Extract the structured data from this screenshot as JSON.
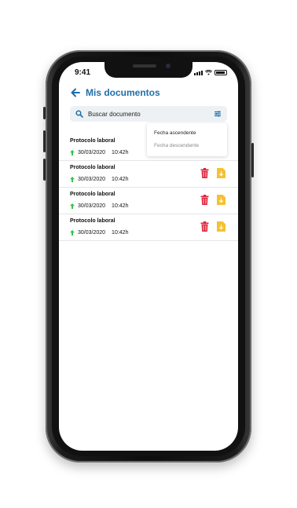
{
  "status": {
    "time": "9:41"
  },
  "header": {
    "title": "Mis documentos"
  },
  "search": {
    "placeholder": "Buscar documento"
  },
  "sort_menu": {
    "options": [
      "Fecha ascendente",
      "Fecha descendente"
    ]
  },
  "documents": [
    {
      "name": "Protocolo laboral",
      "date": "30/03/2020",
      "time": "10:42h"
    },
    {
      "name": "Protocolo laboral",
      "date": "30/03/2020",
      "time": "10:42h"
    },
    {
      "name": "Protocolo laboral",
      "date": "30/03/2020",
      "time": "10:42h"
    },
    {
      "name": "Protocolo laboral",
      "date": "30/03/2020",
      "time": "10:42h"
    }
  ],
  "colors": {
    "accent": "#1f6fa8",
    "upload_arrow": "#3bbf4a",
    "delete": "#e0253c",
    "download": "#f5c033"
  }
}
